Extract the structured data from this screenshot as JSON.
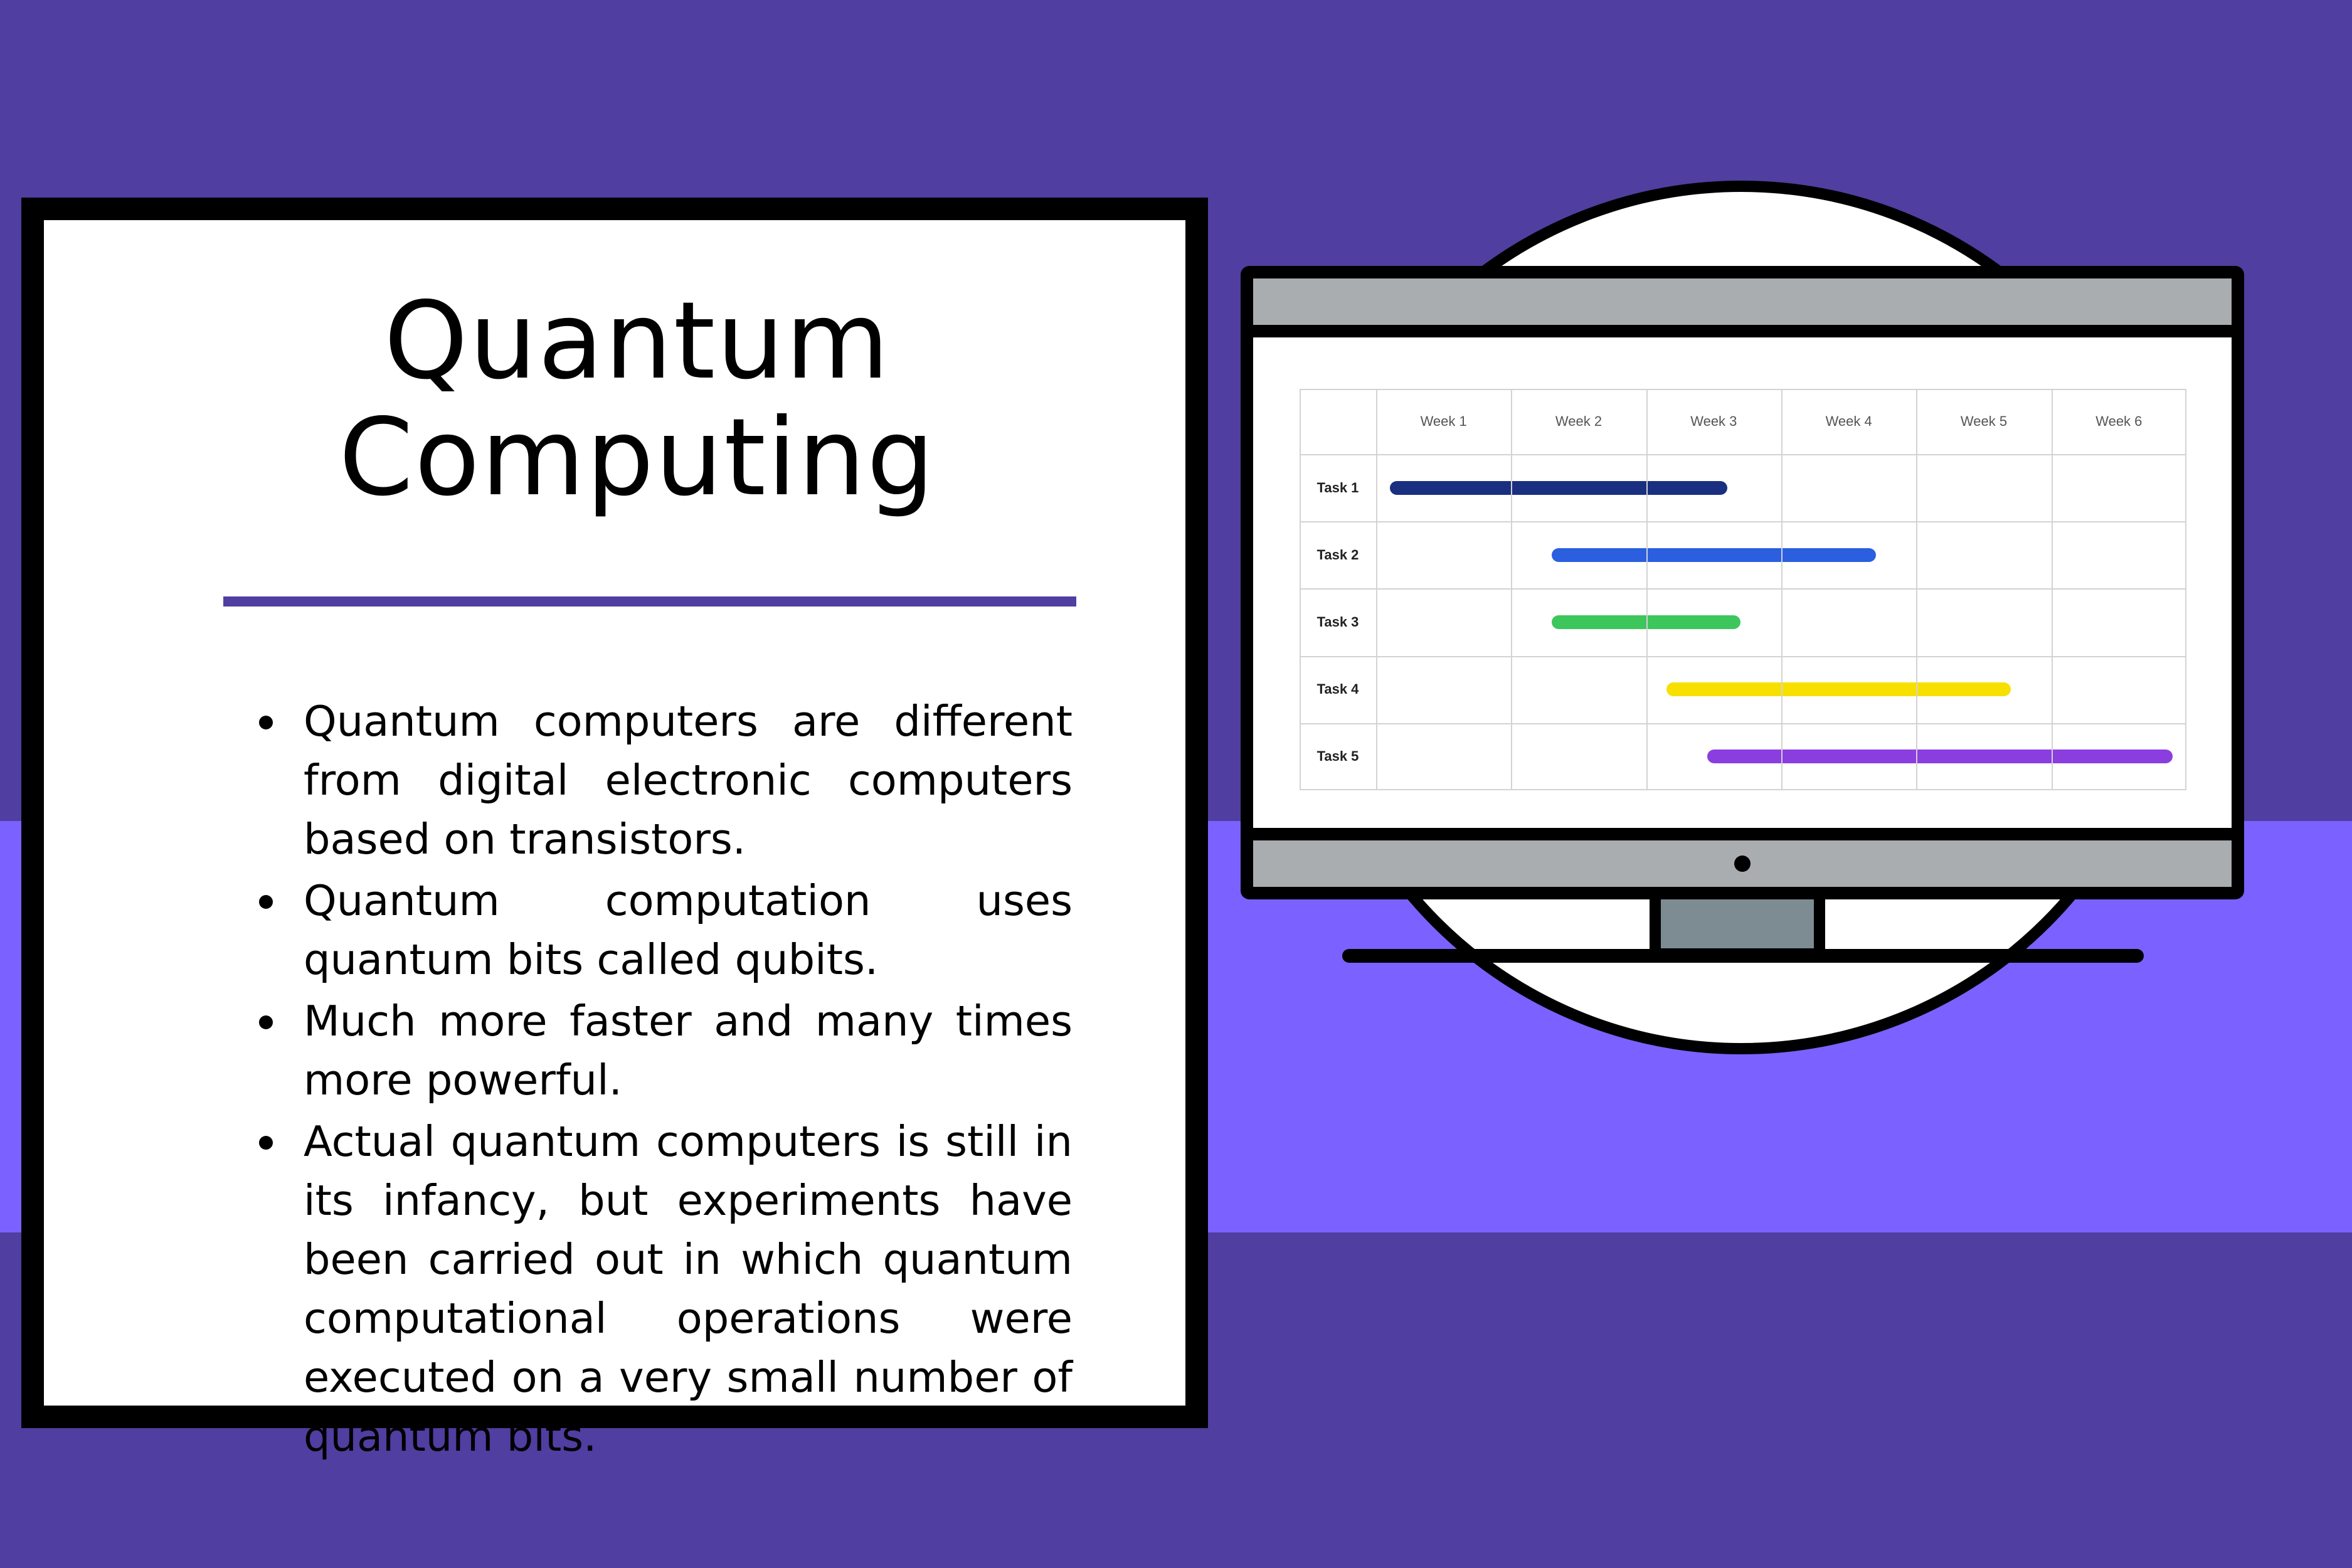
{
  "colors": {
    "background": "#503ea0",
    "band": "#7b61ff",
    "card": "#ffffff",
    "divider": "#503ea0",
    "bezel": "#a9adaf",
    "stand": "#7d8c93"
  },
  "card": {
    "title_line1": "Quantum",
    "title_line2": "Computing",
    "bullets": [
      "Quantum computers are different from digital electronic computers based on transistors.",
      "Quantum computation uses quantum bits called qubits.",
      "Much more faster and many times more powerful.",
      "Actual quantum computers is still in its infancy, but experiments have been carried out in which quantum computational operations were executed on a very small number of quantum bits."
    ]
  },
  "chart_data": {
    "type": "gantt",
    "categories": [
      "Week 1",
      "Week 2",
      "Week 3",
      "Week 4",
      "Week 5",
      "Week 6"
    ],
    "tasks": [
      {
        "name": "Task 1",
        "start": 0.1,
        "end": 2.6,
        "color": "#1a2f80"
      },
      {
        "name": "Task 2",
        "start": 1.3,
        "end": 3.7,
        "color": "#2b5fe0"
      },
      {
        "name": "Task 3",
        "start": 1.3,
        "end": 2.7,
        "color": "#3dc65c"
      },
      {
        "name": "Task 4",
        "start": 2.15,
        "end": 4.7,
        "color": "#f7e000"
      },
      {
        "name": "Task 5",
        "start": 2.45,
        "end": 5.9,
        "color": "#8a3ee0"
      }
    ]
  }
}
